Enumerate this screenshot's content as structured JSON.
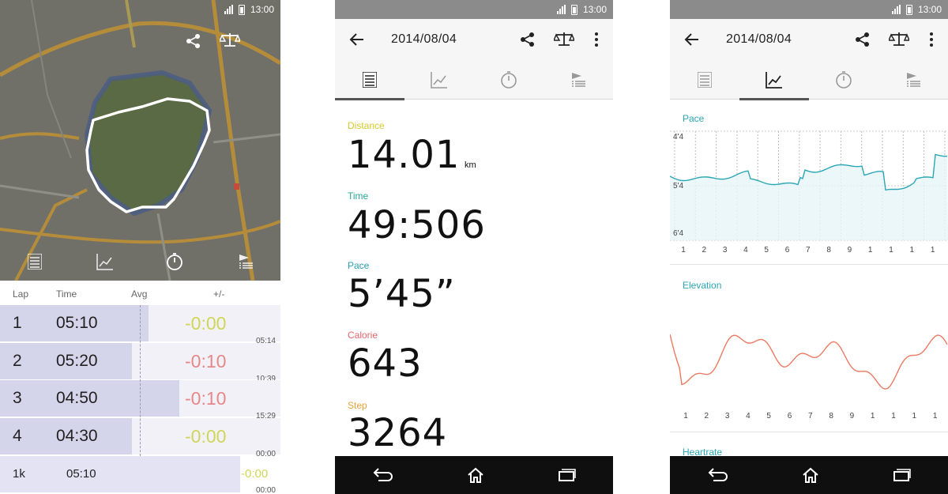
{
  "status": {
    "time": "13:00"
  },
  "screen1": {
    "header": {
      "lap": "Lap",
      "time": "Time",
      "avg": "Avg",
      "diff": "+/-"
    },
    "laps": [
      {
        "num": "1",
        "time": "05:10",
        "diff": "-0:00",
        "diff_color": "#cfd65a",
        "clock": "05:14",
        "bar": 0.53
      },
      {
        "num": "2",
        "time": "05:20",
        "diff": "-0:10",
        "diff_color": "#e7878a",
        "clock": "10:39",
        "bar": 0.47
      },
      {
        "num": "3",
        "time": "04:50",
        "diff": "-0:10",
        "diff_color": "#e7878a",
        "clock": "15:29",
        "bar": 0.64
      },
      {
        "num": "4",
        "time": "04:30",
        "diff": "-0:00",
        "diff_color": "#cfd65a",
        "clock": "00:00",
        "bar": 0.47
      }
    ],
    "total": {
      "label": "1k",
      "time": "05:10",
      "diff": "-0:00",
      "clock": "00:00"
    }
  },
  "screen2": {
    "title": "2014/08/04",
    "stats": [
      {
        "label": "Distance",
        "value": "14.01",
        "color": "#d6c92a"
      },
      {
        "label": "Time",
        "value": "49:506",
        "color": "#2aa79a"
      },
      {
        "label": "Pace",
        "value": "5’45”",
        "color": "#2a9fb2"
      },
      {
        "label": "Calorie",
        "value": "643",
        "color": "#e7656b"
      },
      {
        "label": "Step",
        "value": "3264",
        "color": "#e8a33a"
      }
    ],
    "distance_unit": "km"
  },
  "screen3": {
    "title": "2014/08/04",
    "pace_label": "Pace",
    "elevation_label": "Elevation",
    "heartrate_label": "Heartrate",
    "pace_yticks": [
      "4'4",
      "5'4",
      "6'4"
    ],
    "x_ticks": [
      "1",
      "2",
      "3",
      "4",
      "5",
      "6",
      "7",
      "8",
      "9",
      "1",
      "1",
      "1",
      "1"
    ],
    "colors": {
      "pace": "#2aa7b5",
      "elevation": "#ec7a62"
    }
  },
  "icons": {
    "share": "share-icon",
    "compare": "scale-icon",
    "more": "more-vert-icon",
    "back": "arrow-back-icon",
    "list": "list-icon",
    "chart": "chart-icon",
    "timer": "timer-icon",
    "laps": "flag-list-icon"
  }
}
